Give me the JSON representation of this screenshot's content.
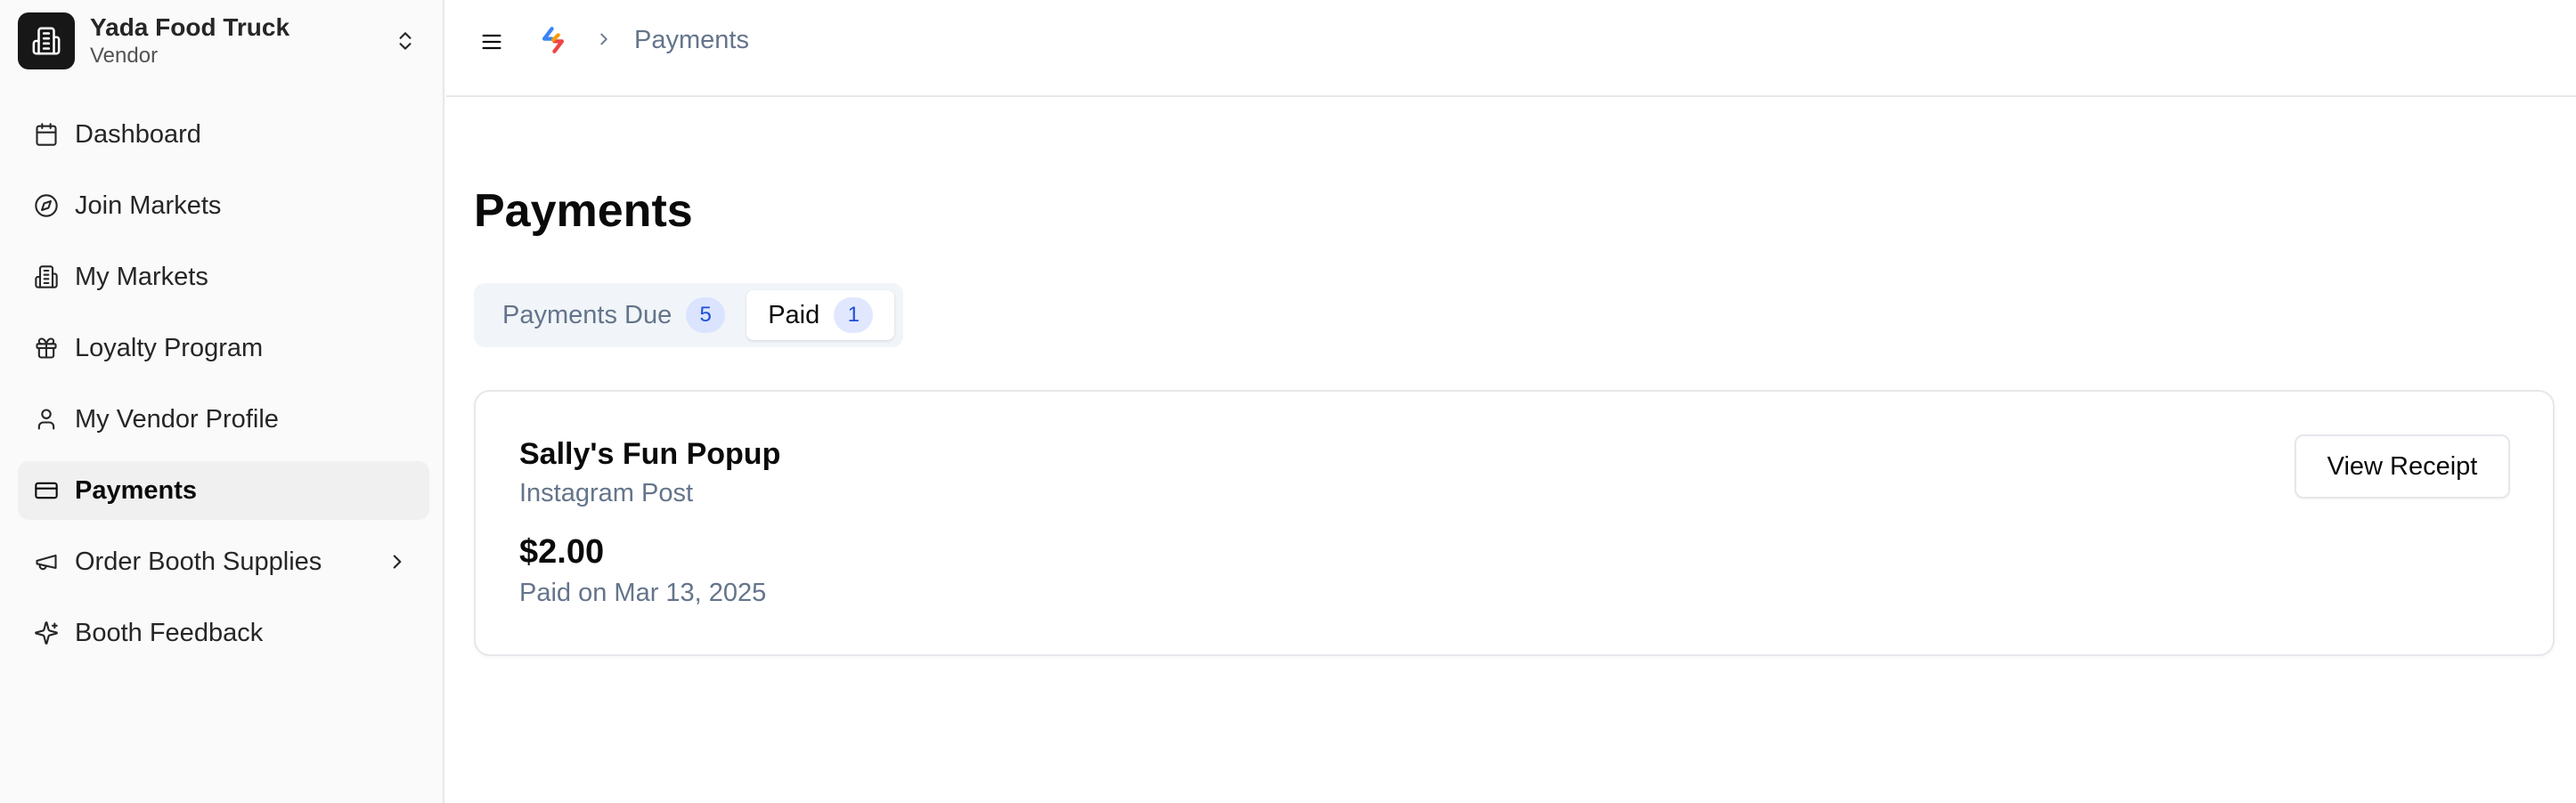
{
  "org": {
    "name": "Yada Food Truck",
    "role": "Vendor"
  },
  "nav": {
    "items": [
      {
        "label": "Dashboard",
        "icon": "calendar-icon"
      },
      {
        "label": "Join Markets",
        "icon": "compass-icon"
      },
      {
        "label": "My Markets",
        "icon": "building-icon"
      },
      {
        "label": "Loyalty Program",
        "icon": "gift-icon"
      },
      {
        "label": "My Vendor Profile",
        "icon": "user-icon"
      },
      {
        "label": "Payments",
        "icon": "credit-card-icon",
        "active": true
      },
      {
        "label": "Order Booth Supplies",
        "icon": "megaphone-icon",
        "has_submenu": true
      },
      {
        "label": "Booth Feedback",
        "icon": "sparkles-icon"
      }
    ]
  },
  "topbar": {
    "breadcrumb": "Payments"
  },
  "page": {
    "title": "Payments"
  },
  "tabs": [
    {
      "label": "Payments Due",
      "count": "5",
      "active": false
    },
    {
      "label": "Paid",
      "count": "1",
      "active": true
    }
  ],
  "payment": {
    "title": "Sally's Fun Popup",
    "subtitle": "Instagram Post",
    "amount": "$2.00",
    "paid_on": "Paid on Mar 13, 2025",
    "button_label": "View Receipt"
  },
  "colors": {
    "active_bg": "#f0f0f0",
    "badge_bg": "#dbe4fe",
    "badge_text": "#1d4ed8",
    "muted_text": "#64748b"
  }
}
